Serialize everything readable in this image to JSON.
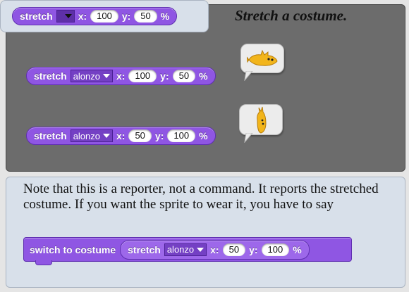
{
  "title": "Stretch a costume.",
  "top_block": {
    "label": "stretch",
    "x_label": "x:",
    "x_value": "100",
    "y_label": "y:",
    "y_value": "50",
    "percent": "%"
  },
  "example1": {
    "label": "stretch",
    "costume": "alonzo",
    "x_label": "x:",
    "x_value": "100",
    "y_label": "y:",
    "y_value": "50",
    "percent": "%"
  },
  "example2": {
    "label": "stretch",
    "costume": "alonzo",
    "x_label": "x:",
    "x_value": "50",
    "y_label": "y:",
    "y_value": "100",
    "percent": "%"
  },
  "note": "Note that this is a reporter, not a command.  It reports the stretched costume.  If you want the sprite to wear it, you have to say",
  "command_block": {
    "label": "switch to costume",
    "stretch": {
      "label": "stretch",
      "costume": "alonzo",
      "x_label": "x:",
      "x_value": "50",
      "y_label": "y:",
      "y_value": "100",
      "percent": "%"
    }
  },
  "icons": {
    "result1": "alonzo-sprite-wide-icon",
    "result2": "alonzo-sprite-tall-icon"
  },
  "colors": {
    "block": "#8f56e3",
    "dark_panel": "#6c6c6c",
    "light_panel": "#d8e0ea",
    "sprite": "#f2b51b"
  }
}
